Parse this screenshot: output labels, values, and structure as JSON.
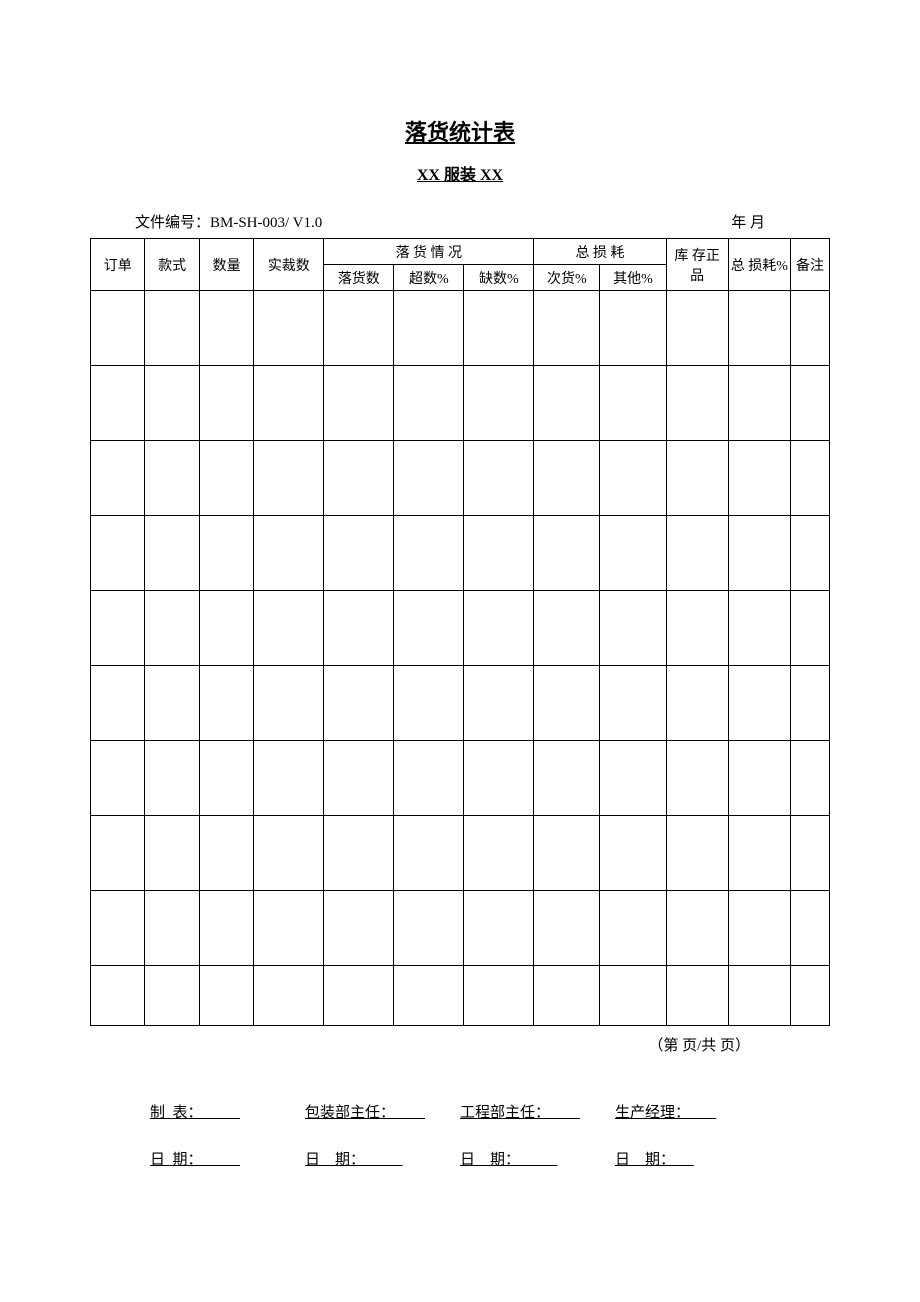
{
  "title": "落货统计表",
  "subtitle": "XX 服装 XX",
  "header": {
    "doc_no": "文件编号：BM-SH-003/ V1.0",
    "date": "年    月"
  },
  "columns": {
    "order": "订单",
    "style": "款式",
    "qty": "数量",
    "actual_cut": "实裁数",
    "fall_group": "落 货 情 况",
    "fall_qty": "落货数",
    "over_pct": "超数%",
    "short_pct": "缺数%",
    "loss_group": "总 损 耗",
    "second_pct": "次货%",
    "other_pct": "其他%",
    "stock": "库 存正品",
    "total_loss": "总 损耗%",
    "remark": "备注"
  },
  "rows": [
    [
      "",
      "",
      "",
      "",
      "",
      "",
      "",
      "",
      "",
      "",
      "",
      ""
    ],
    [
      "",
      "",
      "",
      "",
      "",
      "",
      "",
      "",
      "",
      "",
      "",
      ""
    ],
    [
      "",
      "",
      "",
      "",
      "",
      "",
      "",
      "",
      "",
      "",
      "",
      ""
    ],
    [
      "",
      "",
      "",
      "",
      "",
      "",
      "",
      "",
      "",
      "",
      "",
      ""
    ],
    [
      "",
      "",
      "",
      "",
      "",
      "",
      "",
      "",
      "",
      "",
      "",
      ""
    ],
    [
      "",
      "",
      "",
      "",
      "",
      "",
      "",
      "",
      "",
      "",
      "",
      ""
    ],
    [
      "",
      "",
      "",
      "",
      "",
      "",
      "",
      "",
      "",
      "",
      "",
      ""
    ],
    [
      "",
      "",
      "",
      "",
      "",
      "",
      "",
      "",
      "",
      "",
      "",
      ""
    ],
    [
      "",
      "",
      "",
      "",
      "",
      "",
      "",
      "",
      "",
      "",
      "",
      ""
    ],
    [
      "",
      "",
      "",
      "",
      "",
      "",
      "",
      "",
      "",
      "",
      "",
      ""
    ]
  ],
  "page_note": "（第  页/共  页）",
  "signatures": {
    "row1": {
      "a": "制  表：          ",
      "b": "包装部主任：        ",
      "c": "工程部主任：        ",
      "d": "生产经理：       "
    },
    "row2": {
      "a": "日  期：          ",
      "b": "日    期：          ",
      "c": "日    期：          ",
      "d": "日    期：     "
    }
  }
}
